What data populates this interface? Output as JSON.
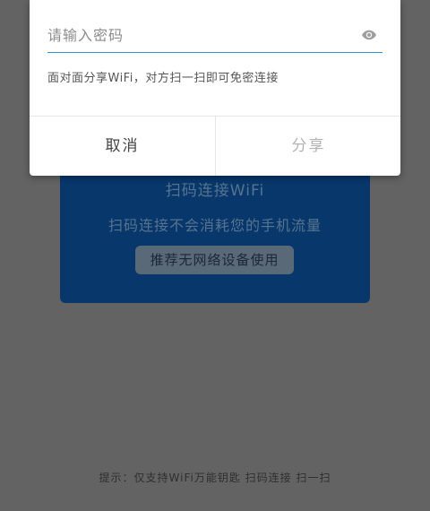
{
  "background_card": {
    "title": "扫码连接WiFi",
    "subtitle": "扫码连接不会消耗您的手机流量",
    "recommend_button": "推荐无网络设备使用"
  },
  "footer_hint": "提示：仅支持WiFi万能钥匙 扫码连接 扫一扫",
  "dialog": {
    "password_placeholder": "请输入密码",
    "password_value": "",
    "eye_icon": "eye-icon",
    "description": "面对面分享WiFi，对方扫一扫即可免密连接",
    "cancel_label": "取消",
    "share_label": "分享"
  },
  "colors": {
    "overlay": "#636363",
    "card": "#08376b",
    "accent_line": "#3a8fd4",
    "share_disabled": "#b3b3b3"
  }
}
